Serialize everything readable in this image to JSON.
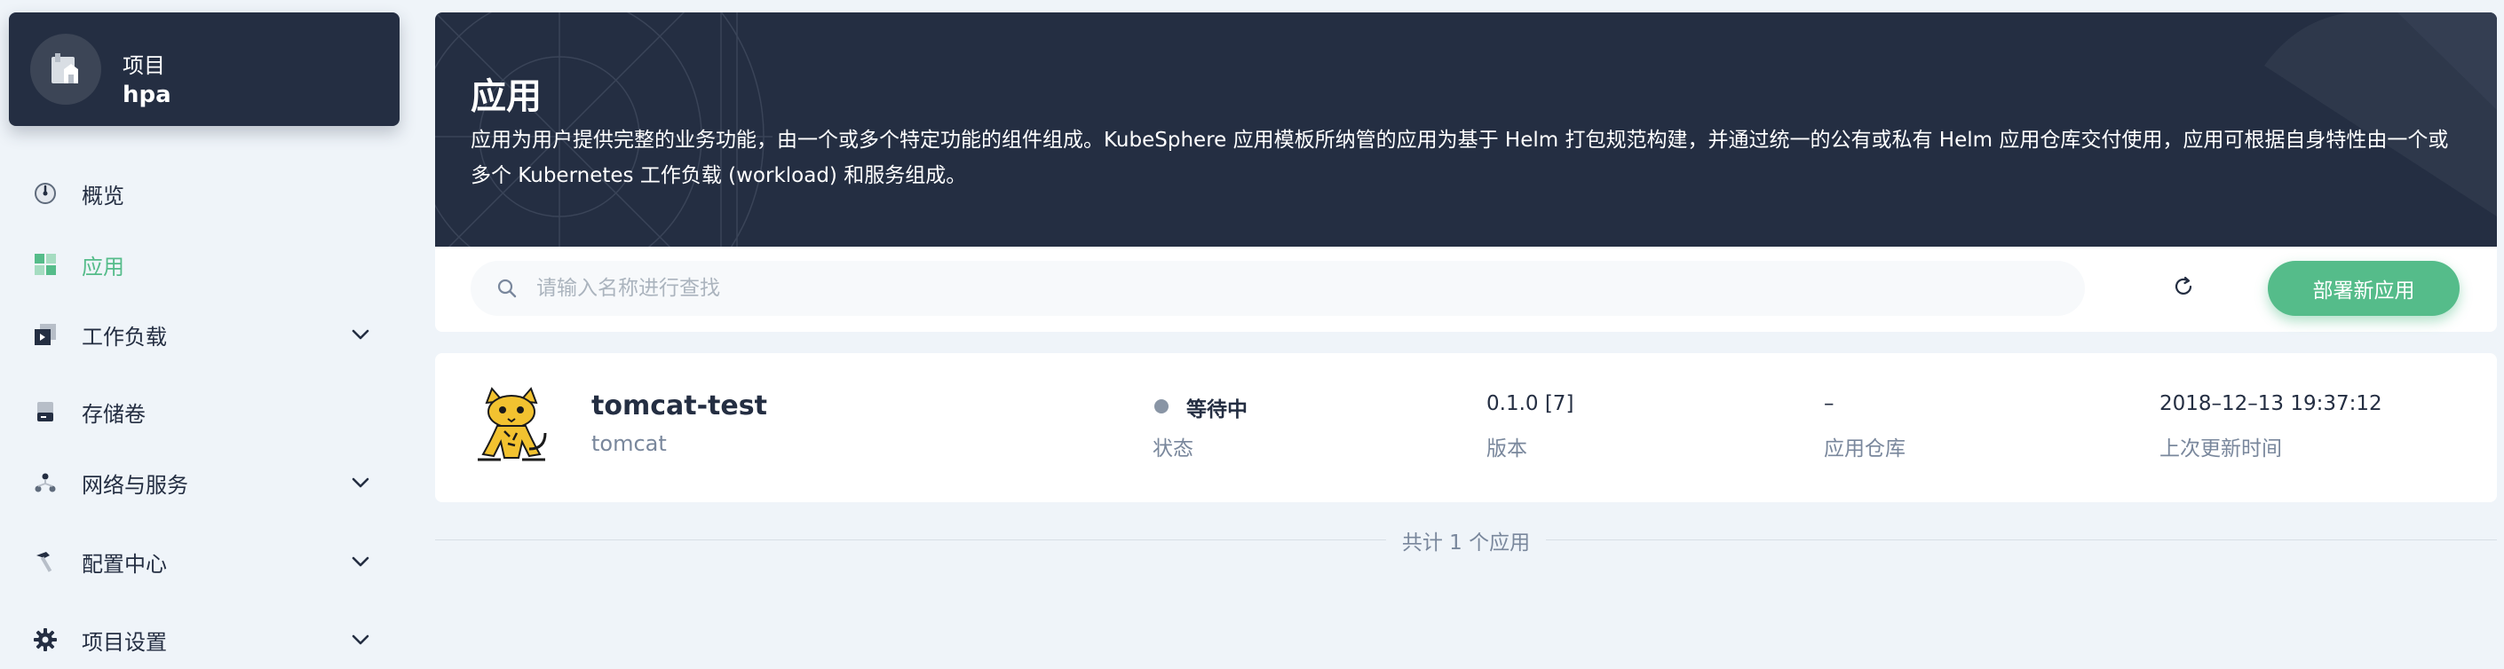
{
  "project": {
    "kind": "项目",
    "name": "hpa",
    "icon": "project-icon"
  },
  "sidebar": {
    "items": [
      {
        "label": "概览",
        "icon": "overview-dial-icon",
        "active": false,
        "expandable": false
      },
      {
        "label": "应用",
        "icon": "apps-grid-icon",
        "active": true,
        "expandable": false
      },
      {
        "label": "工作负载",
        "icon": "workload-icon",
        "active": false,
        "expandable": true
      },
      {
        "label": "存储卷",
        "icon": "storage-volume-icon",
        "active": false,
        "expandable": false
      },
      {
        "label": "网络与服务",
        "icon": "network-icon",
        "active": false,
        "expandable": true
      },
      {
        "label": "配置中心",
        "icon": "hammer-icon",
        "active": false,
        "expandable": true
      },
      {
        "label": "项目设置",
        "icon": "gear-icon",
        "active": false,
        "expandable": true
      }
    ]
  },
  "banner": {
    "title": "应用",
    "description": "应用为用户提供完整的业务功能，由一个或多个特定功能的组件组成。KubeSphere 应用模板所纳管的应用为基于 Helm 打包规范构建，并通过统一的公有或私有 Helm 应用仓库交付使用，应用可根据自身特性由一个或多个 Kubernetes 工作负载 (workload) 和服务组成。"
  },
  "toolbar": {
    "search_placeholder": "请输入名称进行查找",
    "search_value": "",
    "refresh_icon": "refresh-icon",
    "deploy_label": "部署新应用"
  },
  "apps": [
    {
      "name": "tomcat-test",
      "subtitle": "tomcat",
      "logo": "tomcat-logo",
      "status": "等待中",
      "status_label": "状态",
      "version": "0.1.0 [7]",
      "version_label": "版本",
      "repo": "–",
      "repo_label": "应用仓库",
      "updated": "2018–12–13 19:37:12",
      "updated_label": "上次更新时间"
    }
  ],
  "footer": {
    "total_text": "共计 1 个应用"
  },
  "colors": {
    "accent": "#55bc8a",
    "dark": "#242e42",
    "muted": "#79879c",
    "background": "#eff4f9",
    "status_pending": "#8995a5"
  }
}
